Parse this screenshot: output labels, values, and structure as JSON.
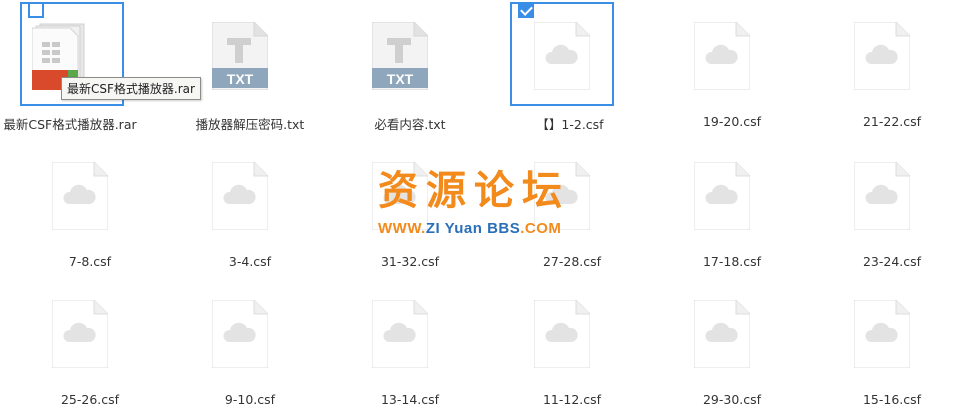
{
  "tooltip": "最新CSF格式播放器.rar",
  "watermark": {
    "cn": "资源论坛",
    "en_www": "WWW.",
    "en_zi": "ZI",
    "en_yuan": " Yuan ",
    "en_bbs": "BBS",
    "en_com": ".COM"
  },
  "files": [
    {
      "name": "最新CSF格式播放器.rar",
      "type": "rar",
      "checked": false
    },
    {
      "name": "播放器解压密码.txt",
      "type": "txt"
    },
    {
      "name": "必看内容.txt",
      "type": "txt"
    },
    {
      "name": "【】1-2.csf",
      "type": "csf",
      "checked": true
    },
    {
      "name": "19-20.csf",
      "type": "csf"
    },
    {
      "name": "21-22.csf",
      "type": "csf"
    },
    {
      "name": "7-8.csf",
      "type": "csf"
    },
    {
      "name": "3-4.csf",
      "type": "csf"
    },
    {
      "name": "31-32.csf",
      "type": "csf"
    },
    {
      "name": "27-28.csf",
      "type": "csf"
    },
    {
      "name": "17-18.csf",
      "type": "csf"
    },
    {
      "name": "23-24.csf",
      "type": "csf"
    },
    {
      "name": "25-26.csf",
      "type": "csf"
    },
    {
      "name": "9-10.csf",
      "type": "csf"
    },
    {
      "name": "13-14.csf",
      "type": "csf"
    },
    {
      "name": "11-12.csf",
      "type": "csf"
    },
    {
      "name": "29-30.csf",
      "type": "csf"
    },
    {
      "name": "15-16.csf",
      "type": "csf"
    }
  ],
  "txt_badge": "TXT"
}
